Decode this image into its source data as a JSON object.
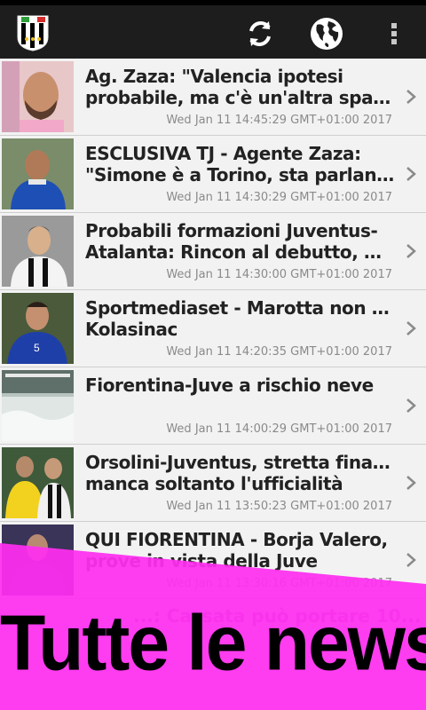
{
  "app_bar": {
    "logo_icon": "juventus-logo",
    "refresh_icon": "refresh-icon",
    "globe_icon": "globe-icon",
    "menu_icon": "more-vert-icon",
    "background": "#1d1d1d"
  },
  "news": [
    {
      "title_1": "Ag. Zaza: \"Valencia ipotesi",
      "title_2": "probabile, ma c'è un'altra spagnola\"",
      "date": "Wed Jan 11 14:45:29 GMT+01:00 2017"
    },
    {
      "title_1": "ESCLUSIVA TJ - Agente Zaza:",
      "title_2": "\"Simone è a Torino, sta parlando c...",
      "date": "Wed Jan 11 14:30:29 GMT+01:00 2017"
    },
    {
      "title_1": "Probabili formazioni Juventus-",
      "title_2": "Atalanta: Rincon al debutto, Dybal...",
      "date": "Wed Jan 11 14:30:00 GMT+01:00 2017"
    },
    {
      "title_1": "Sportmediaset - Marotta non molla",
      "title_2": "Kolasinac",
      "date": "Wed Jan 11 14:20:35 GMT+01:00 2017"
    },
    {
      "title_1": "Fiorentina-Juve a rischio neve",
      "title_2": "",
      "date": "Wed Jan 11 14:00:29 GMT+01:00 2017"
    },
    {
      "title_1": "Orsolini-Juventus, stretta finale:",
      "title_2": "manca soltanto l'ufficialità",
      "date": "Wed Jan 11 13:50:23 GMT+01:00 2017"
    },
    {
      "title_1": "QUI FIORENTINA - Borja Valero,",
      "title_2": "prove in vista della Juve",
      "date": "Wed Jan 11 13:30:16 GMT+01:00 2017"
    }
  ],
  "partial_item_text": "...: Cassata può portare 10...",
  "banner": {
    "text": "Tutte le news",
    "color": "#ff2ef0"
  }
}
